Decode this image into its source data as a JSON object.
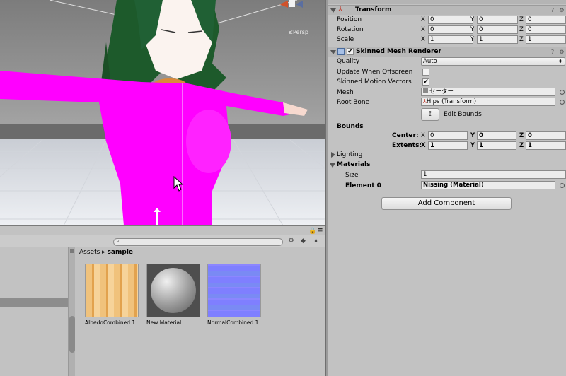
{
  "scene": {
    "persp_label": "≤Persp",
    "colors": {
      "sky": "#8d8d8d",
      "ground": "#e7e9ee",
      "body": "#ff00ff",
      "hair": "#1d5a2b"
    }
  },
  "project": {
    "breadcrumb": {
      "root": "Assets",
      "separator": "▸",
      "current": "sample"
    },
    "assets": [
      {
        "label": "AlbedoCombined 1"
      },
      {
        "label": "New Material"
      },
      {
        "label": "NormalCombined 1"
      }
    ]
  },
  "inspector": {
    "transform": {
      "title": "Transform",
      "position": {
        "label": "Position",
        "x": "0",
        "y": "0",
        "z": "0"
      },
      "rotation": {
        "label": "Rotation",
        "x": "0",
        "y": "0",
        "z": "0"
      },
      "scale": {
        "label": "Scale",
        "x": "1",
        "y": "1",
        "z": "1"
      }
    },
    "axis": {
      "x": "X",
      "y": "Y",
      "z": "Z"
    },
    "smr": {
      "title": "Skinned Mesh Renderer",
      "quality_label": "Quality",
      "quality_value": "Auto",
      "update_offscreen_label": "Update When Offscreen",
      "motion_vectors_label": "Skinned Motion Vectors",
      "mesh_label": "Mesh",
      "mesh_value": "セーター",
      "root_bone_label": "Root Bone",
      "root_bone_value": "Hips (Transform)",
      "edit_bounds_label": "Edit Bounds",
      "bounds_label": "Bounds",
      "center_label": "Center:",
      "center": {
        "x": "0",
        "y": "0",
        "z": "0"
      },
      "extents_label": "Extents:",
      "extents": {
        "x": "1",
        "y": "1",
        "z": "1"
      },
      "lighting_label": "Lighting",
      "materials_label": "Materials",
      "size_label": "Size",
      "size_value": "1",
      "element0_label": "Element 0",
      "element0_value": "Nissing (Material)"
    },
    "add_component_label": "Add Component"
  }
}
